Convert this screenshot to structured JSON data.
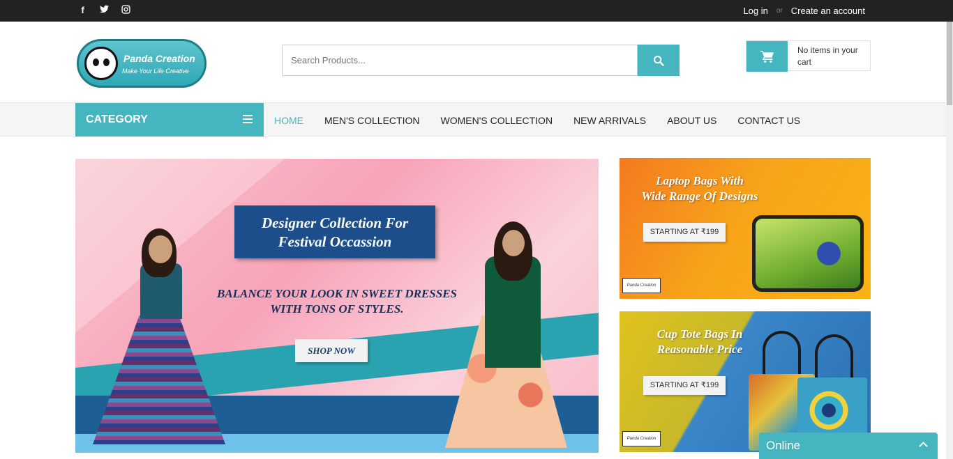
{
  "topbar": {
    "social": [
      "f",
      "t",
      "ig"
    ],
    "login": "Log in",
    "or": "or",
    "create_account": "Create an account"
  },
  "logo": {
    "name": "Panda Creation",
    "tagline": "Make Your Life Creative"
  },
  "search": {
    "placeholder": "Search Products..."
  },
  "cart": {
    "text": "No items in your cart"
  },
  "nav": {
    "category": "CATEGORY",
    "links": [
      "HOME",
      "MEN'S COLLECTION",
      "WOMEN'S COLLECTION",
      "NEW ARRIVALS",
      "ABOUT US",
      "CONTACT US"
    ]
  },
  "hero": {
    "title_line1": "Designer Collection For",
    "title_line2": "Festival Occassion",
    "sub_line1": "BALANCE YOUR LOOK IN SWEET DRESSES",
    "sub_line2": "WITH TONS OF STYLES.",
    "cta": "SHOP NOW"
  },
  "promos": [
    {
      "title_line1": "Laptop Bags With",
      "title_line2": "Wide Range Of Designs",
      "badge": "STARTING AT ₹199",
      "logo": "Panda Creation"
    },
    {
      "title_line1": "Cup Tote Bags In",
      "title_line2": "Reasonable Price",
      "badge": "STARTING AT ₹199",
      "logo": "Panda Creation"
    }
  ],
  "chat": {
    "status": "Online"
  },
  "colors": {
    "accent": "#45b5c0",
    "topbar": "#222222"
  }
}
